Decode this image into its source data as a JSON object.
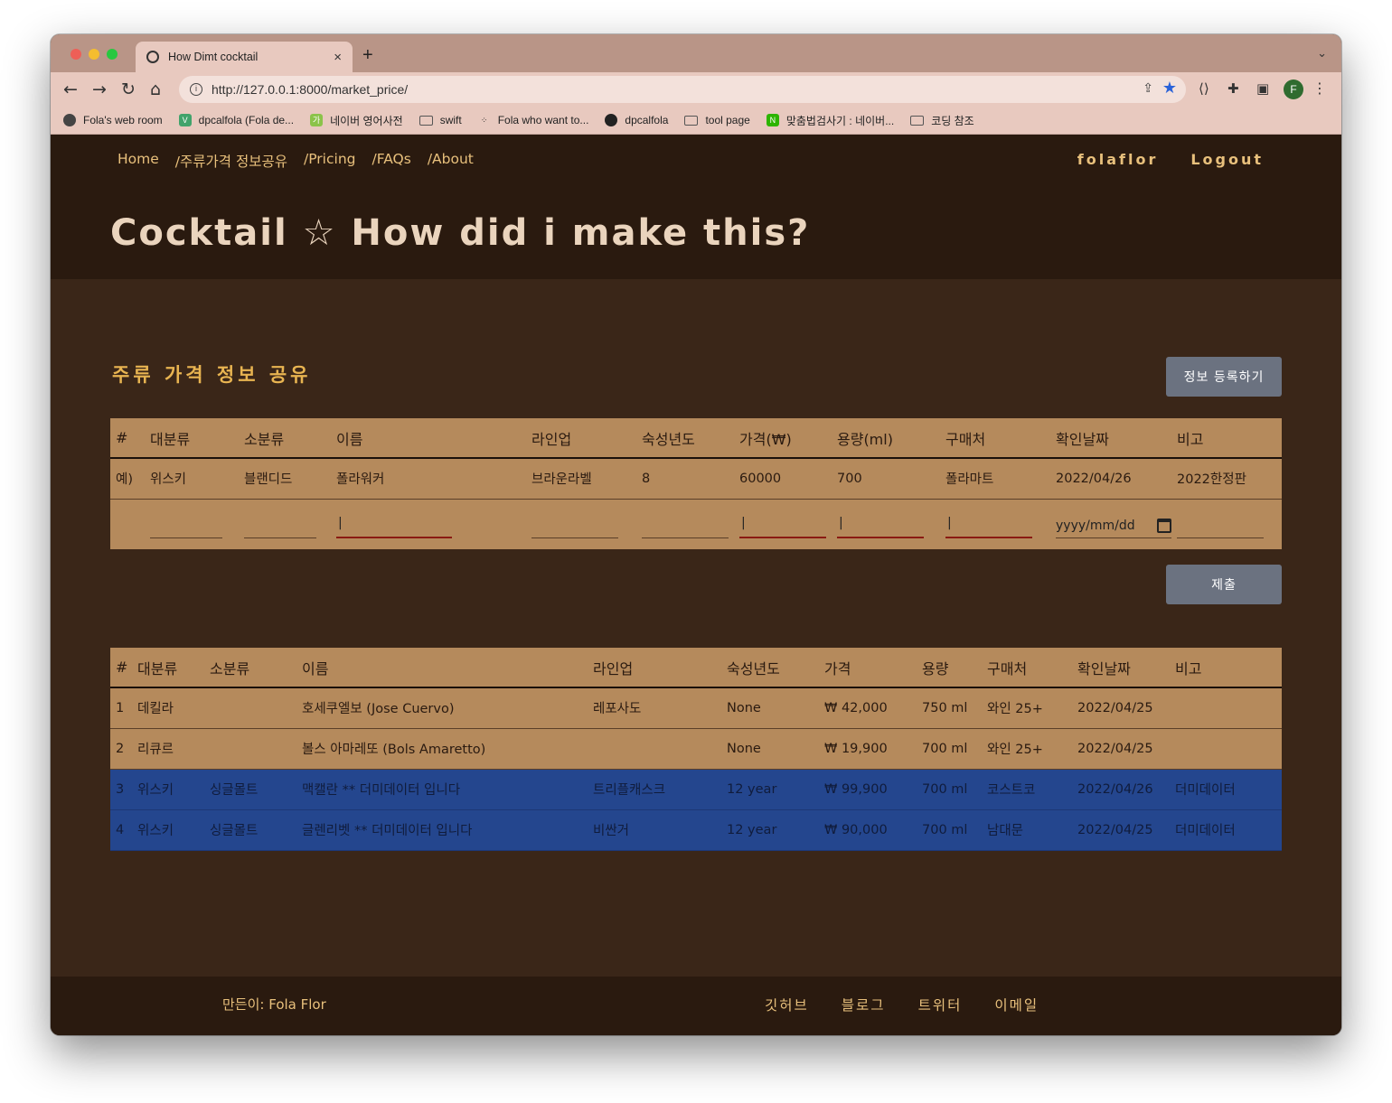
{
  "browser": {
    "tab_title": "How Dimt cocktail",
    "tab_close": "×",
    "new_tab": "+",
    "tabs_menu": "⌄",
    "url": "http://127.0.0.1:8000/market_price/",
    "profile_initial": "F",
    "bookmarks": [
      {
        "label": "Fola's web room",
        "icon": "globe-icon"
      },
      {
        "label": "dpcalfola (Fola de...",
        "icon": "vue-icon"
      },
      {
        "label": "네이버 영어사전",
        "icon": "naver-dict-icon"
      },
      {
        "label": "swift",
        "icon": "folder-icon"
      },
      {
        "label": "Fola who want to...",
        "icon": "dots-icon"
      },
      {
        "label": "dpcalfola",
        "icon": "github-icon"
      },
      {
        "label": "tool page",
        "icon": "folder-icon"
      },
      {
        "label": "맞춤법검사기 : 네이버...",
        "icon": "naver-icon"
      },
      {
        "label": "코딩 참조",
        "icon": "folder-icon"
      }
    ]
  },
  "site": {
    "nav": [
      "Home",
      "/주류가격 정보공유",
      "/Pricing",
      "/FAQs",
      "/About"
    ],
    "user": "folaflor",
    "logout": "Logout",
    "title": "Cocktail ☆ How did i make this?"
  },
  "section": {
    "title": "주류 가격 정보 공유",
    "register_button": "정보 등록하기",
    "submit_button": "제출"
  },
  "form_table": {
    "headers": [
      "#",
      "대분류",
      "소분류",
      "이름",
      "라인업",
      "숙성년도",
      "가격(₩)",
      "용량(ml)",
      "구매처",
      "확인날짜",
      "비고"
    ],
    "example": [
      "예)",
      "위스키",
      "블랜디드",
      "폴라워커",
      "브라운라벨",
      "8",
      "60000",
      "700",
      "폴라마트",
      "2022/04/26",
      "2022한정판"
    ],
    "inputs": {
      "name": "|",
      "price": "|",
      "volume": "|",
      "store": "|",
      "date_placeholder": "yyyy/mm/dd"
    }
  },
  "data_table": {
    "headers": [
      "#",
      "대분류",
      "소분류",
      "이름",
      "라인업",
      "숙성년도",
      "가격",
      "용량",
      "구매처",
      "확인날짜",
      "비고"
    ],
    "rows": [
      [
        "1",
        "데킬라",
        "",
        "호세쿠엘보 (Jose Cuervo)",
        "레포사도",
        "None",
        "₩ 42,000",
        "750 ml",
        "와인 25+",
        "2022/04/25",
        ""
      ],
      [
        "2",
        "리큐르",
        "",
        "볼스 아마레또 (Bols Amaretto)",
        "",
        "None",
        "₩ 19,900",
        "700 ml",
        "와인 25+",
        "2022/04/25",
        ""
      ],
      [
        "3",
        "위스키",
        "싱글몰트",
        "맥캘란 ** 더미데이터 입니다",
        "트리플캐스크",
        "12 year",
        "₩ 99,900",
        "700 ml",
        "코스트코",
        "2022/04/26",
        "더미데이터"
      ],
      [
        "4",
        "위스키",
        "싱글몰트",
        "글렌리벳 ** 더미데이터 입니다",
        "비싼거",
        "12 year",
        "₩ 90,000",
        "700 ml",
        "남대문",
        "2022/04/25",
        "더미데이터"
      ]
    ]
  },
  "footer": {
    "credit": "만든이: Fola Flor",
    "links": [
      "깃허브",
      "블로그",
      "트위터",
      "이메일"
    ]
  },
  "colors": {
    "header_bg": "#2a1a0f",
    "page_bg": "#3a2618",
    "table_bg": "#b58a5c",
    "dummy_row_bg": "#24468e",
    "accent_text": "#e8c07c",
    "button_bg": "#6b7280"
  }
}
